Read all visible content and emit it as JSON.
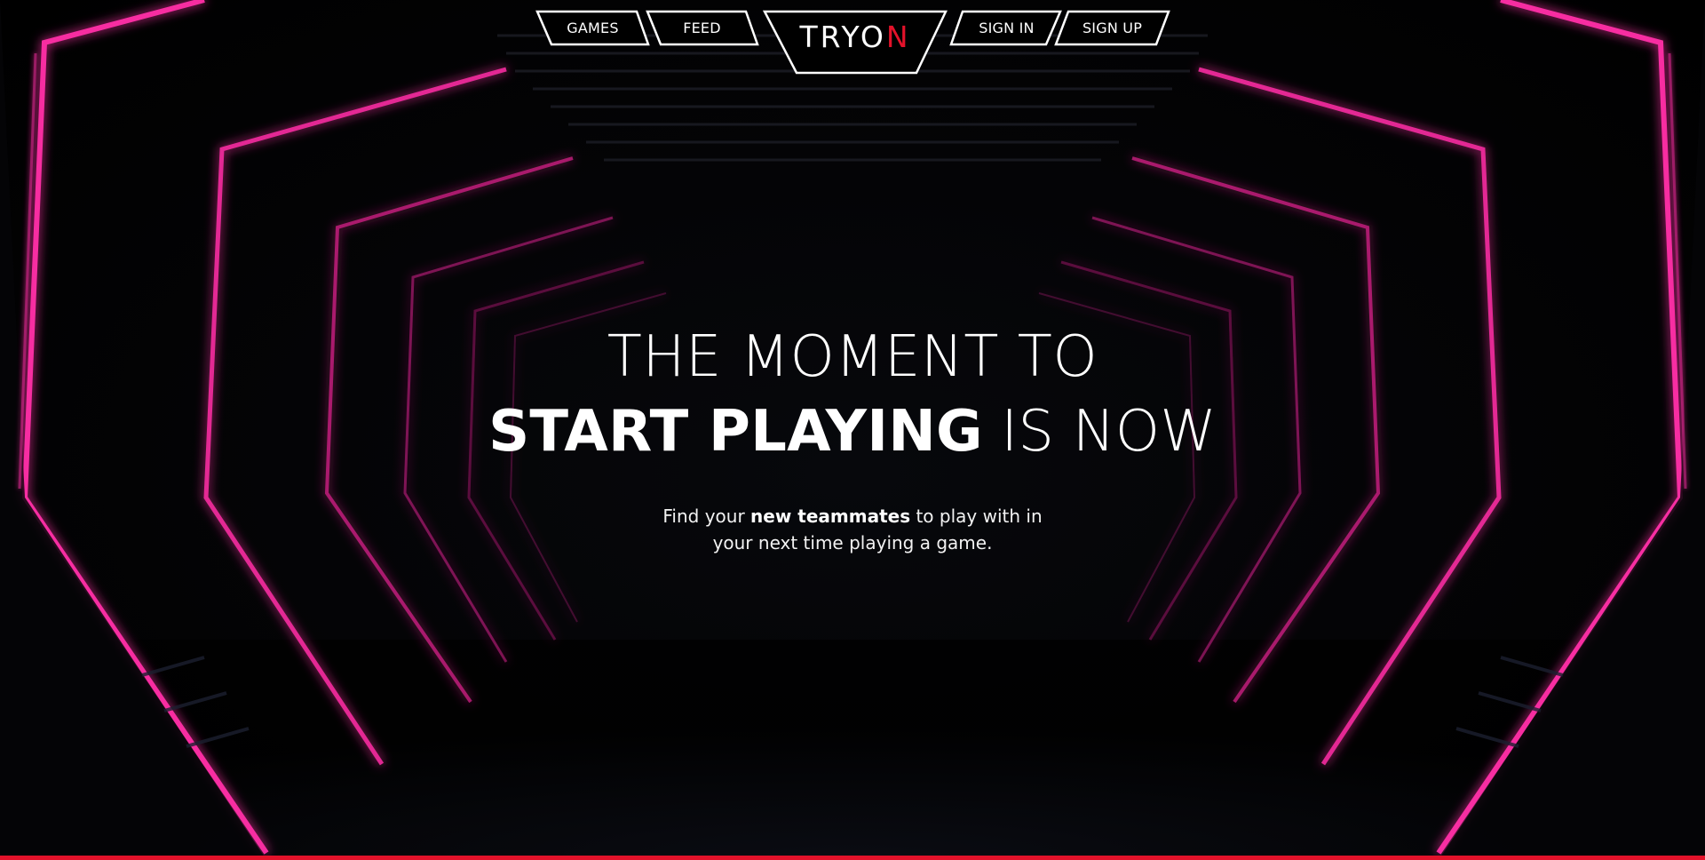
{
  "nav": {
    "games_label": "GAMES",
    "feed_label": "FEED",
    "signin_label": "SIGN IN",
    "signup_label": "SIGN UP"
  },
  "logo": {
    "text_main": "TRYO",
    "text_accent_letter": "N"
  },
  "hero": {
    "line1": "THE MOMENT TO",
    "line2_bold": "START PLAYING",
    "line2_light": " IS NOW",
    "sub_part1": "Find your ",
    "sub_bold": "new teammates",
    "sub_part2": " to play with in",
    "sub_line2": "your next time playing a game."
  },
  "colors": {
    "accent_red": "#e3122a",
    "neon_pink": "#ff2fa6",
    "background": "#000000",
    "text": "#ffffff"
  }
}
